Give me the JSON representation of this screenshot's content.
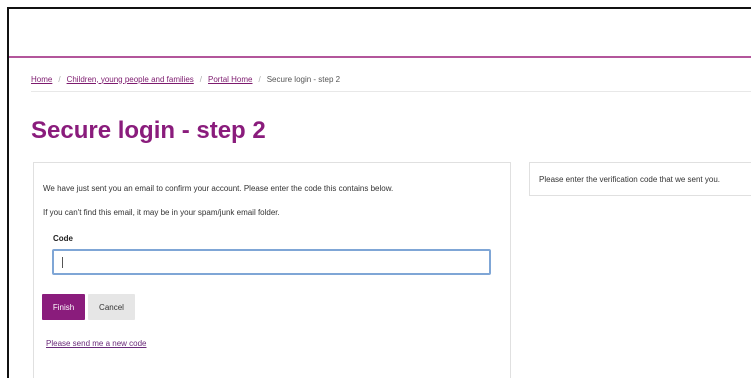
{
  "breadcrumb": {
    "items": [
      "Home",
      "Children, young people and families",
      "Portal Home"
    ],
    "current": "Secure login - step 2"
  },
  "page": {
    "title": "Secure login - step 2"
  },
  "form": {
    "intro_line1": "We have just sent you an email to confirm your account. Please enter the code this contains below.",
    "intro_line2": "If you can't find this email, it may be in your spam/junk email folder.",
    "code_label": "Code",
    "code_value": "",
    "finish_label": "Finish",
    "cancel_label": "Cancel",
    "new_code_link": "Please send me a new code"
  },
  "sidebar": {
    "hint": "Please enter the verification code that we sent you."
  },
  "colors": {
    "brand": "#8a1c7c",
    "header_rule": "#b3569b",
    "input_focus": "#7fa6d6"
  }
}
